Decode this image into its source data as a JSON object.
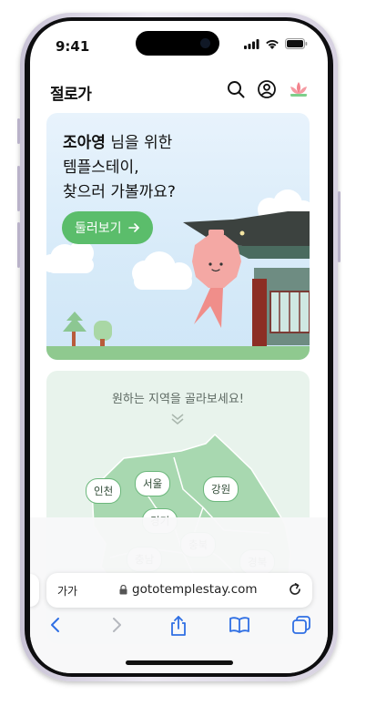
{
  "status_bar": {
    "time": "9:41"
  },
  "app_bar": {
    "brand": "절로가",
    "icons": [
      "search-icon",
      "account-icon",
      "lotus-logo-icon"
    ]
  },
  "hero": {
    "name": "조아영",
    "line1_suffix": " 님을 위한",
    "line2": "템플스테이,",
    "line3": "찾으러 가볼까요?",
    "cta_label": "둘러보기",
    "cta_icon": "arrow-right-icon"
  },
  "region": {
    "title": "원하는 지역을 골라보세요!",
    "regions": [
      "인천",
      "서울",
      "강원",
      "경기",
      "충북",
      "충남",
      "경북"
    ]
  },
  "browser": {
    "text_size_button": "가가",
    "url": "gototemplestay.com",
    "toolbar": [
      "back-icon",
      "forward-icon",
      "share-icon",
      "bookmarks-icon",
      "tabs-icon"
    ]
  },
  "colors": {
    "brand_green": "#5bbd6b",
    "map_green": "#a8d8b0",
    "sky": "#dcedfa",
    "chip_border": "#6bb77b"
  }
}
